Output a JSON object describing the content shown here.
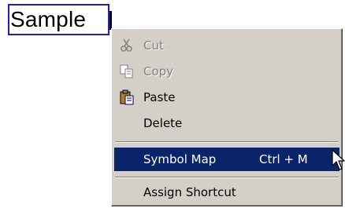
{
  "textbox": {
    "text": "Sample"
  },
  "menu": {
    "cut": {
      "label": "Cut",
      "icon": "scissors-icon",
      "enabled": false
    },
    "copy": {
      "label": "Copy",
      "icon": "copy-icon",
      "enabled": false
    },
    "paste": {
      "label": "Paste",
      "icon": "clipboard-icon",
      "enabled": true
    },
    "delete": {
      "label": "Delete",
      "enabled": true
    },
    "symbol_map": {
      "label": "Symbol Map",
      "shortcut": "Ctrl + M",
      "selected": true
    },
    "assign_shortcut": {
      "label": "Assign Shortcut",
      "enabled": true
    }
  },
  "colors": {
    "menu_bg": "#d4d0c8",
    "highlight": "#0a246a",
    "textbox_border": "#1c1cd0",
    "disabled_text": "#808080"
  }
}
